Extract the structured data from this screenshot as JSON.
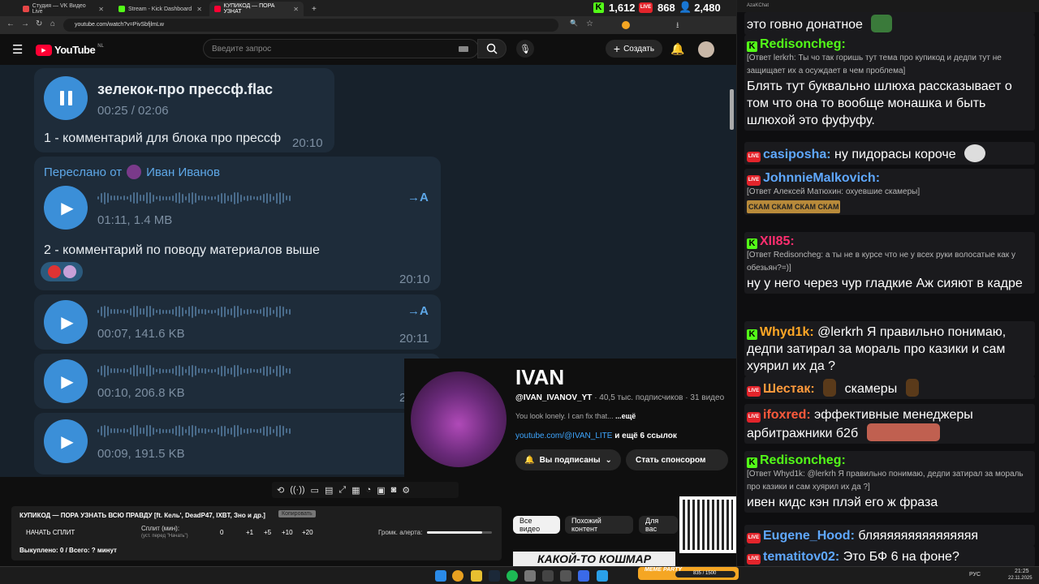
{
  "browser": {
    "tabs": [
      {
        "title": "Студия — VK Видео Live",
        "color": "#e64646"
      },
      {
        "title": "Stream - Kick Dashboard",
        "color": "#53fc18"
      },
      {
        "title": "КУПИКОД — ПОРА УЗНАТ",
        "color": "#ff0033"
      }
    ],
    "new_tab": "+",
    "url": "youtube.com/watch?v=PivSbfjlmLw"
  },
  "stats": {
    "kick_viewers": "1,612",
    "vk_viewers": "868",
    "yt_viewers": "2,480"
  },
  "youtube": {
    "logo": "YouTube",
    "region": "NL",
    "search_placeholder": "Введите запрос",
    "create_label": "Создать"
  },
  "telegram": {
    "msg1": {
      "file": "зелекок-про прессф.flac",
      "duration": "00:25 / 02:06",
      "caption": "1 - комментарий для блока про прессф",
      "time": "20:10"
    },
    "forward": {
      "label": "Переслано от",
      "author": "Иван Иванов"
    },
    "msg2": {
      "meta": "01:11, 1.4 MB",
      "caption": "2 - комментарий по поводу материалов выше",
      "time": "20:10",
      "tr": "→A"
    },
    "msg3": {
      "meta": "00:07, 141.6 KB",
      "time": "20:11",
      "tr": "→A"
    },
    "msg4": {
      "meta": "00:10, 206.8 KB",
      "time": "2"
    },
    "msg5": {
      "meta": "00:09, 191.5 KB"
    }
  },
  "channel": {
    "name": "IVAN",
    "handle": "@IVAN_IVANOV_YT",
    "stats": "· 40,5 тыс. подписчиков · 31 видео",
    "desc": "You look lonely. I can fix that...",
    "more": "...ещё",
    "link": "youtube.com/@IVAN_LITE",
    "link_more": "и ещё 6 ссылок",
    "subscribed": "Вы подписаны",
    "sponsor": "Стать спонсором"
  },
  "timer": {
    "title": "КУПИКОД — ПОРА УЗНАТЬ ВСЮ ПРАВДУ [ft. Кель', DeadP47, IXBT, Зно и др.]",
    "copy": "Копировать",
    "start": "НАЧАТЬ СПЛИТ",
    "split_label": "Сплит (мин):",
    "split_hint": "(уст. перед \"Начать\")",
    "split_value": "0",
    "buttons": [
      "+1",
      "+5",
      "+10",
      "+20"
    ],
    "volume_label": "Громк. алерта:",
    "bought": "Выкуплено: 0 / Всего: ? минут",
    "volume_value": 0.85
  },
  "chips": [
    "Все видео",
    "Похожий контент",
    "Для вас"
  ],
  "thumb_text": "КАКОЙ-ТО КОШМАР",
  "chat": {
    "title": "AzaKChat",
    "messages": [
      {
        "txt": "это говно донатное"
      },
      {
        "platform": "kick",
        "user": "Redisoncheg:",
        "color": "#53fc18",
        "reply": "[Ответ lerkrh: Ты чо так горишь тут тема про купикод и дедпи тут не защищает их а осуждает в чем проблема]",
        "txt": "Блять тут буквально шлюха рассказывает о том что она то вообще монашка и быть шлюхой это фуфуфу."
      },
      {
        "platform": "vk",
        "user": "casiposha:",
        "color": "#5fa8ff",
        "txt": "ну пидорасы короче"
      },
      {
        "platform": "vk",
        "user": "JohnnieMalkovich:",
        "color": "#5fa8ff",
        "reply": "[Ответ Алексей Матюхин: охуевшие скамеры]",
        "txt": "СКАМ СКАМ СКАМ СКАМ"
      },
      {
        "platform": "kick",
        "user": "XII85:",
        "color": "#ff2e6f",
        "reply": "[Ответ Redisoncheg: а ты не в курсе что не у всех руки волосатые как у обезьян?=)]",
        "txt": "ну у него через чур гладкие Аж сияют в кадре"
      },
      {
        "platform": "kick",
        "user": "Whyd1k:",
        "color": "#ffa726",
        "txt": "@lerkrh Я правильно понимаю, дедпи затирал за мораль про казики и сам хуярил их да ?"
      },
      {
        "platform": "vk",
        "user": "Шестак:",
        "color": "#ff9a3c",
        "txt": "скамеры"
      },
      {
        "platform": "vk",
        "user": "ifoxred:",
        "color": "#ff5a3c",
        "txt": "эффективные менеджеры арбитражники б2б"
      },
      {
        "platform": "kick",
        "user": "Redisoncheg:",
        "color": "#53fc18",
        "reply": "[Ответ Whyd1k: @lerkrh Я правильно понимаю, дедпи затирал за мораль про казики и сам хуярил их да ?]",
        "txt": "ивен кидс кэн плэй его ж фраза"
      },
      {
        "platform": "vk",
        "user": "Eugene_Hood:",
        "color": "#5fa8ff",
        "txt": "бляяяяяяяяяяяяяяя"
      },
      {
        "platform": "vk",
        "user": "tematitov02:",
        "color": "#5fa8ff",
        "txt": "Это БФ 6 на фоне?"
      }
    ]
  },
  "taskbar": {
    "meme_party": "MEME PARTY",
    "progress": "835 / 1500",
    "lang": "РУС",
    "time": "21:25",
    "date": "22.11.2025"
  }
}
